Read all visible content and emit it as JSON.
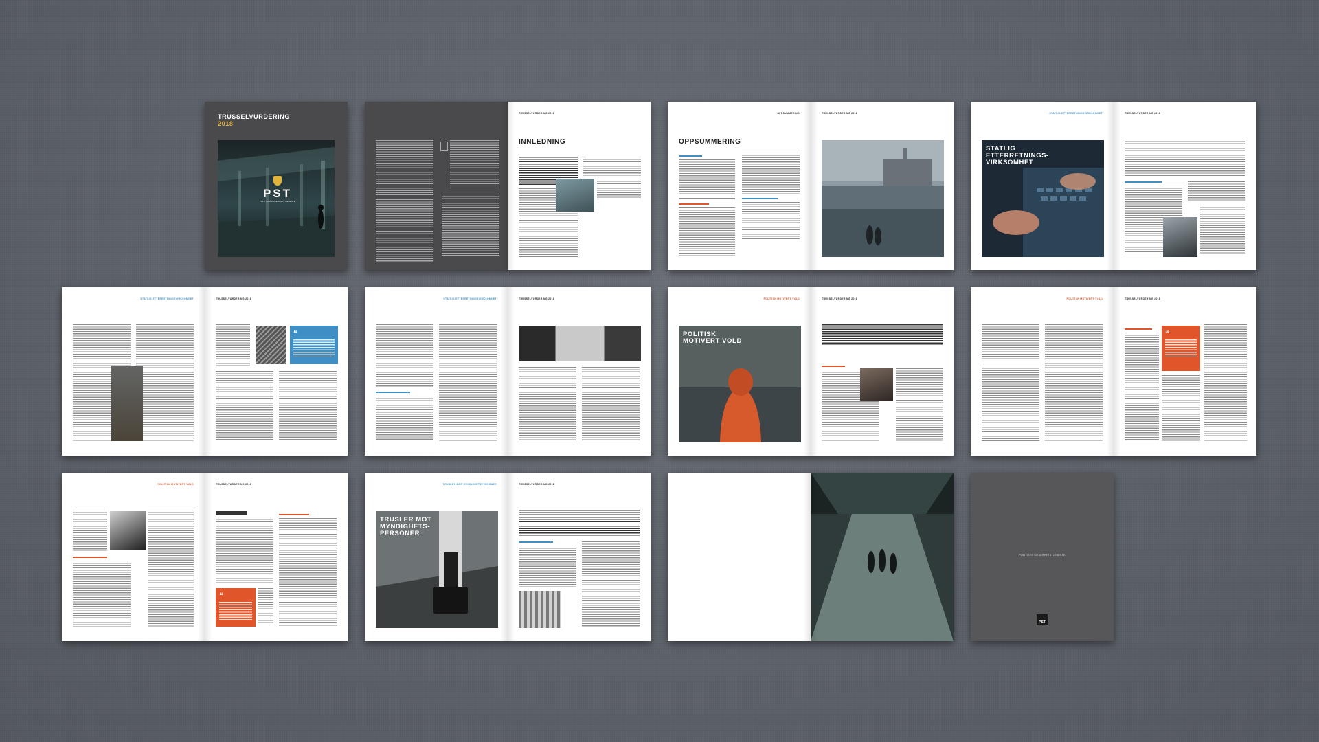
{
  "cover": {
    "title": "TRUSSELVURDERING",
    "year": "2018",
    "logo": "PST",
    "logo_subtitle": "POLITIETS SIKKERHETSTJENESTE"
  },
  "running_head": {
    "main": "TRUSSELVURDERING 2018",
    "statlig": "STATLIG ETTERRETNINGSVIRKSOMHET",
    "politisk": "POLITISK MOTIVERT VOLD",
    "trusler": "TRUSLER MOT MYNDIGHETSPERSONER"
  },
  "sections": {
    "innledning": "INNLEDNING",
    "oppsummering": "OPPSUMMERING",
    "statlig": "STATLIG ETTERRETNINGS-VIRKSOMHET",
    "politisk": "POLITISK MOTIVERT VOLD",
    "trusler": "TRUSLER MOT MYNDIGHETS-PERSONER"
  },
  "back_cover": {
    "org": "POLITIETS SIKKERHETSTJENESTE",
    "logo": "PST"
  },
  "colors": {
    "background": "#5f636b",
    "accent_blue": "#3f8fc4",
    "accent_red": "#e0552a",
    "accent_yellow": "#e2b43a",
    "cover_dark": "#4a4a4d"
  }
}
